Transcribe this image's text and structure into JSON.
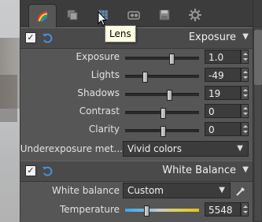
{
  "tabs": [
    {
      "name": "color",
      "icon": "color-rainbow-icon"
    },
    {
      "name": "detail",
      "icon": "layers-icon"
    },
    {
      "name": "lens",
      "icon": "lens-grid-icon"
    },
    {
      "name": "metadata",
      "icon": "exif-icon"
    },
    {
      "name": "output",
      "icon": "save-icon"
    },
    {
      "name": "settings",
      "icon": "gear-icon"
    }
  ],
  "tooltip": "Lens",
  "exposure_section": {
    "title": "Exposure",
    "enabled": true,
    "rows": [
      {
        "label": "Exposure",
        "value": "1.0",
        "level": 0.62
      },
      {
        "label": "Lights",
        "value": "-49",
        "level": 0.26
      },
      {
        "label": "Shadows",
        "value": "19",
        "level": 0.58
      },
      {
        "label": "Contrast",
        "value": "0",
        "level": 0.5
      },
      {
        "label": "Clarity",
        "value": "0",
        "level": 0.5
      }
    ],
    "underexposure": {
      "label": "Underexposure met...",
      "value": "Vivid colors"
    }
  },
  "white_balance_section": {
    "title": "White Balance",
    "enabled": true,
    "white_balance": {
      "label": "White balance",
      "value": "Custom"
    },
    "temperature": {
      "label": "Temperature",
      "value": "5548",
      "level": 0.28
    }
  }
}
